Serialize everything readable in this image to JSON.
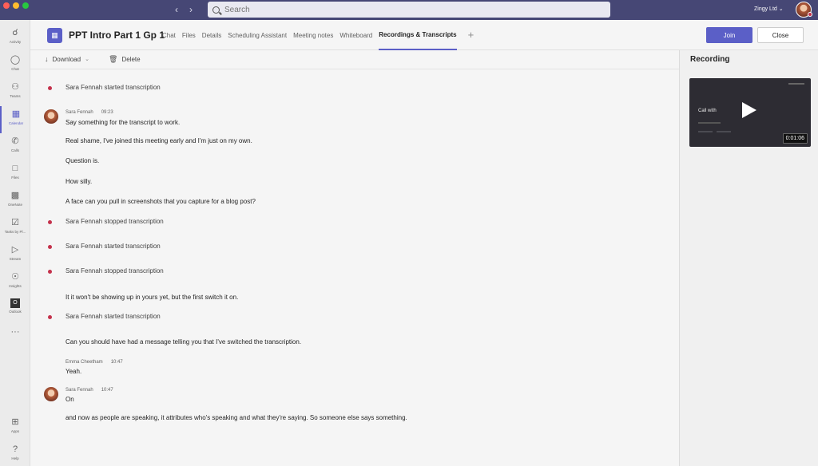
{
  "titlebar": {
    "search_placeholder": "Search",
    "org_name": "Zingy Ltd ⌄"
  },
  "rail": [
    {
      "label": "Activity",
      "icon": "bell-icon"
    },
    {
      "label": "Chat",
      "icon": "chat-icon"
    },
    {
      "label": "Teams",
      "icon": "teams-icon"
    },
    {
      "label": "Calendar",
      "icon": "calendar-icon"
    },
    {
      "label": "Calls",
      "icon": "phone-icon"
    },
    {
      "label": "Files",
      "icon": "file-icon"
    },
    {
      "label": "OneNote",
      "icon": "onenote-icon"
    },
    {
      "label": "Tasks by Pl...",
      "icon": "tasks-icon"
    },
    {
      "label": "Stream",
      "icon": "stream-icon"
    },
    {
      "label": "Insights",
      "icon": "insights-icon"
    },
    {
      "label": "Outlook",
      "icon": "outlook-icon"
    },
    {
      "label": "",
      "icon": "more-icon"
    },
    {
      "label": "Apps",
      "icon": "apps-icon"
    },
    {
      "label": "Help",
      "icon": "help-icon"
    }
  ],
  "header": {
    "title": "PPT Intro Part 1 Gp 1",
    "tabs": [
      "Chat",
      "Files",
      "Details",
      "Scheduling Assistant",
      "Meeting notes",
      "Whiteboard",
      "Recordings & Transcripts"
    ],
    "active_tab": "Recordings & Transcripts",
    "join_label": "Join",
    "close_label": "Close"
  },
  "toolbar": {
    "download_label": "Download",
    "delete_label": "Delete"
  },
  "transcript": {
    "ev1": "Sara Fennah started transcription",
    "s1_name": "Sara Fennah",
    "s1_time": "09:23",
    "l1": "Say something for the transcript to work.",
    "l2": "Real shame, I've joined this meeting early and I'm just on my own.",
    "l3": "Question is.",
    "l4": "How silly.",
    "l5": "A face can you pull in screenshots that you capture for a blog post?",
    "ev2": "Sara Fennah stopped transcription",
    "ev3": "Sara Fennah started transcription",
    "ev4": "Sara Fennah stopped transcription",
    "l6": "It it won't be showing up in yours yet, but the first switch it on.",
    "ev5": "Sara Fennah started transcription",
    "l7": "Can you should have had a message telling you that I've switched the transcription.",
    "s2_name": "Emma Cheetham",
    "s2_time": "10:47",
    "l8": "Yeah.",
    "s3_name": "Sara Fennah",
    "s3_time": "10:47",
    "l9": "On",
    "l10": "and now as people are speaking, it attributes who's speaking and what they're saying. So someone else says something."
  },
  "recording": {
    "title": "Recording",
    "thumb_text": "Call with",
    "duration": "0:01:06"
  }
}
